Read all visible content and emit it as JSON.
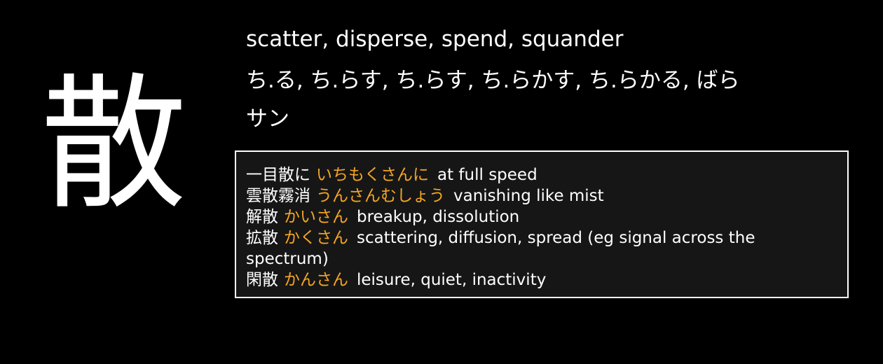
{
  "kanji": "散",
  "meaning": "scatter, disperse, spend, squander",
  "kun_readings": "ち.る, ち.らす, ち.らす, ち.らかす, ち.らかる, ばら",
  "on_readings": "サン",
  "colors": {
    "background": "#000000",
    "text": "#ffffff",
    "reading_accent": "#f5a623",
    "panel_background": "#161616",
    "panel_border": "#ffffff"
  },
  "examples": [
    {
      "word": "一目散に",
      "reading": "いちもくさんに",
      "gloss": "at full speed"
    },
    {
      "word": "雲散霧消",
      "reading": "うんさんむしょう",
      "gloss": "vanishing like mist"
    },
    {
      "word": "解散",
      "reading": "かいさん",
      "gloss": "breakup, dissolution"
    },
    {
      "word": "拡散",
      "reading": "かくさん",
      "gloss": "scattering, diffusion, spread (eg signal across the spectrum)"
    },
    {
      "word": "閑散",
      "reading": "かんさん",
      "gloss": "leisure, quiet, inactivity"
    }
  ]
}
